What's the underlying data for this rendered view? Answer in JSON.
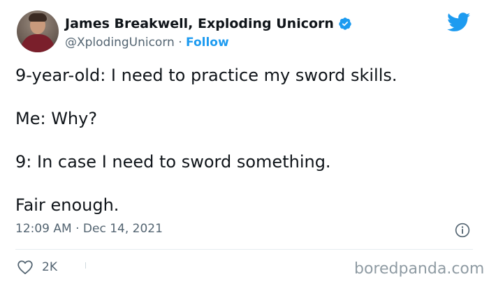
{
  "author": {
    "display_name": "James Breakwell, Exploding Unicorn",
    "handle": "@XplodingUnicorn",
    "separator": "·",
    "follow_label": "Follow"
  },
  "tweet": {
    "lines": [
      "9-year-old: I need to practice my sword skills.",
      "Me: Why?",
      "9: In case I need to sword something.",
      "Fair enough."
    ],
    "timestamp": "12:09 AM · Dec 14, 2021"
  },
  "actions": {
    "like_count": "2K"
  },
  "watermark": "boredpanda.com",
  "colors": {
    "twitter_blue": "#1d9bf0",
    "secondary_text": "#536471",
    "primary_text": "#0f1419"
  },
  "icons": {
    "verified": "verified-badge-icon",
    "twitter": "twitter-bird-icon",
    "info": "info-icon",
    "like": "heart-icon"
  }
}
